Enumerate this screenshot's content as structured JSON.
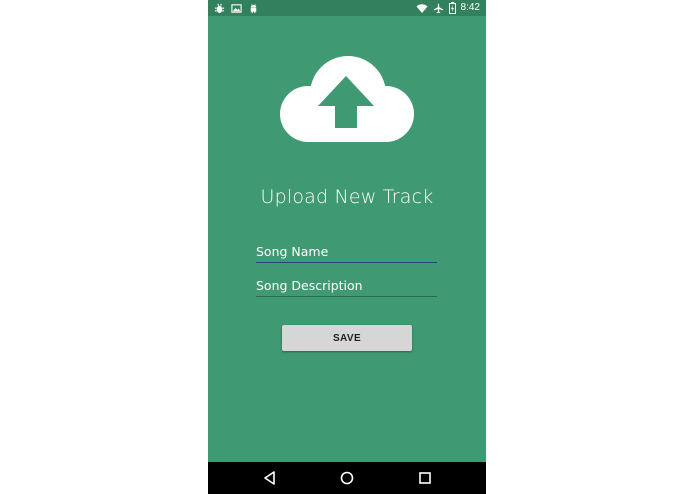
{
  "status_bar": {
    "time": "8:42",
    "left_icons": [
      "debug-icon",
      "image-icon",
      "android-icon"
    ],
    "right_icons": [
      "wifi-icon",
      "airplane-icon",
      "battery-charging-icon"
    ],
    "background": "#33805e"
  },
  "screen": {
    "background": "#3f9a73",
    "hero_icon": "cloud-upload-icon",
    "title": "Upload New Track"
  },
  "form": {
    "song_name_placeholder": "Song Name",
    "song_description_placeholder": "Song Description",
    "save_label": "SAVE"
  },
  "nav_bar": {
    "icons": [
      "back-icon",
      "home-icon",
      "recents-icon"
    ]
  }
}
